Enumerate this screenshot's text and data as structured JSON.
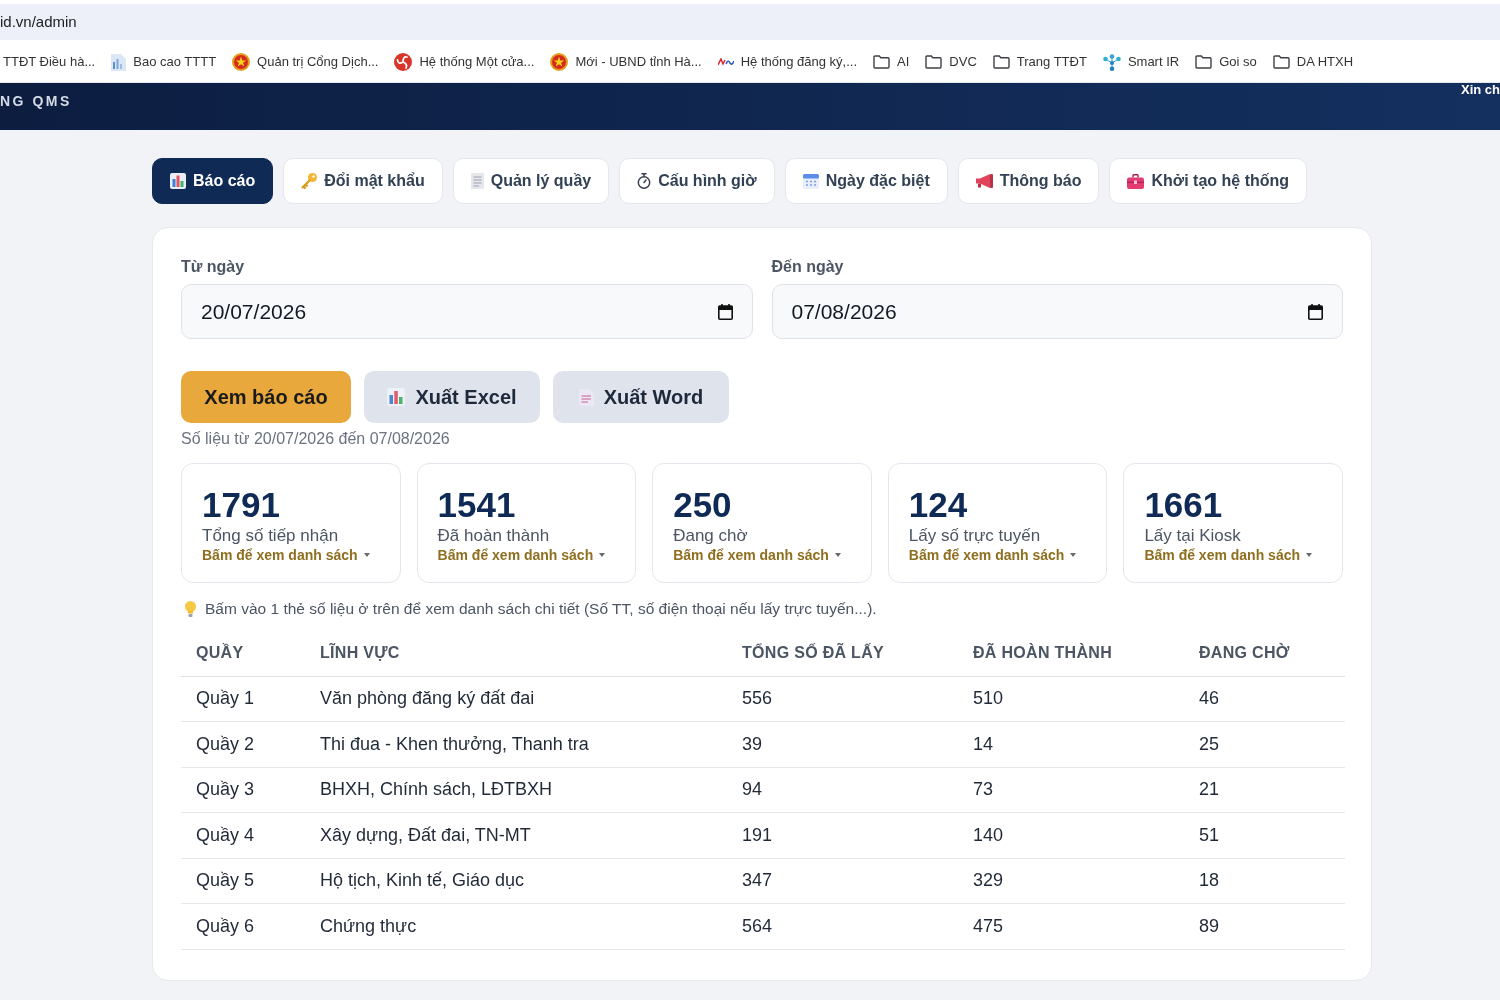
{
  "browser": {
    "address": "id.vn/admin",
    "bookmarks": [
      {
        "label": "TTĐT Điều hà...",
        "kind": "plain"
      },
      {
        "label": "Bao cao TTTT",
        "kind": "document"
      },
      {
        "label": "Quản trị Cổng Dịch...",
        "kind": "emblem"
      },
      {
        "label": "Hệ thống Một cửa...",
        "kind": "swirl"
      },
      {
        "label": "Mới - UBND tỉnh Hà...",
        "kind": "emblem"
      },
      {
        "label": "Hệ thống đăng ký,...",
        "kind": "wave"
      },
      {
        "label": "AI",
        "kind": "folder"
      },
      {
        "label": "DVC",
        "kind": "folder"
      },
      {
        "label": "Trang TTĐT",
        "kind": "folder"
      },
      {
        "label": "Smart IR",
        "kind": "nodes"
      },
      {
        "label": "Goi so",
        "kind": "folder"
      },
      {
        "label": "DA HTXH",
        "kind": "folder"
      }
    ]
  },
  "header": {
    "title": "NG QMS",
    "greeting": "Xin ch"
  },
  "tabs": [
    {
      "label": "Báo cáo",
      "selected": true
    },
    {
      "label": "Đổi mật khẩu",
      "selected": false
    },
    {
      "label": "Quản lý quầy",
      "selected": false
    },
    {
      "label": "Cấu hình giờ",
      "selected": false
    },
    {
      "label": "Ngày đặc biệt",
      "selected": false
    },
    {
      "label": "Thông báo",
      "selected": false
    },
    {
      "label": "Khởi tạo hệ thống",
      "selected": false
    }
  ],
  "report": {
    "date_from": {
      "label": "Từ ngày",
      "value": "20/07/2026"
    },
    "date_to": {
      "label": "Đến ngày",
      "value": "07/08/2026"
    },
    "buttons": [
      {
        "label": "Xem báo cáo",
        "kind": "primary"
      },
      {
        "label": "Xuất Excel",
        "kind": "excel"
      },
      {
        "label": "Xuất Word",
        "kind": "word"
      }
    ],
    "range_note": "Số liệu từ 20/07/2026 đến 07/08/2026",
    "stats": [
      {
        "value": "1791",
        "label": "Tổng số tiếp nhận",
        "link": "Bấm để xem danh sách"
      },
      {
        "value": "1541",
        "label": "Đã hoàn thành",
        "link": "Bấm để xem danh sách"
      },
      {
        "value": "250",
        "label": "Đang chờ",
        "link": "Bấm để xem danh sách"
      },
      {
        "value": "124",
        "label": "Lấy số trực tuyến",
        "link": "Bấm để xem danh sách"
      },
      {
        "value": "1661",
        "label": "Lấy tại Kiosk",
        "link": "Bấm để xem danh sách"
      }
    ],
    "hint": "Bấm vào 1 thẻ số liệu ở trên để xem danh sách chi tiết (Số TT, số điện thoại nếu lấy trực tuyến...).",
    "table": {
      "columns": [
        "QUẦY",
        "LĨNH VỰC",
        "TỔNG SỐ ĐÃ LẤY",
        "ĐÃ HOÀN THÀNH",
        "ĐANG CHỜ"
      ],
      "rows": [
        [
          "Quầy 1",
          "Văn phòng đăng ký đất đai",
          "556",
          "510",
          "46"
        ],
        [
          "Quầy 2",
          "Thi đua - Khen thưởng, Thanh tra",
          "39",
          "14",
          "25"
        ],
        [
          "Quầy 3",
          "BHXH, Chính sách, LĐTBXH",
          "94",
          "73",
          "21"
        ],
        [
          "Quầy 4",
          "Xây dựng, Đất đai, TN-MT",
          "191",
          "140",
          "51"
        ],
        [
          "Quầy 5",
          "Hộ tịch, Kinh tế, Giáo dục",
          "347",
          "329",
          "18"
        ],
        [
          "Quầy 6",
          "Chứng thực",
          "564",
          "475",
          "89"
        ]
      ]
    }
  }
}
